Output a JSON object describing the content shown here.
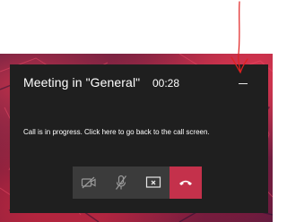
{
  "popup": {
    "title": "Meeting in \"General\"",
    "timer": "00:28",
    "message": "Call is in progress. Click here to go back to the call screen."
  },
  "controls": [
    {
      "name": "camera-toggle-button",
      "icon": "camera-off-icon"
    },
    {
      "name": "microphone-toggle-button",
      "icon": "microphone-off-icon"
    },
    {
      "name": "share-screen-button",
      "icon": "share-screen-icon"
    },
    {
      "name": "hang-up-button",
      "icon": "hang-up-icon"
    }
  ],
  "colors": {
    "popup_background": "#1f1f1f",
    "control_background": "#3b3b3b",
    "hangup_background": "#c4314b",
    "annotation": "#e02020"
  }
}
